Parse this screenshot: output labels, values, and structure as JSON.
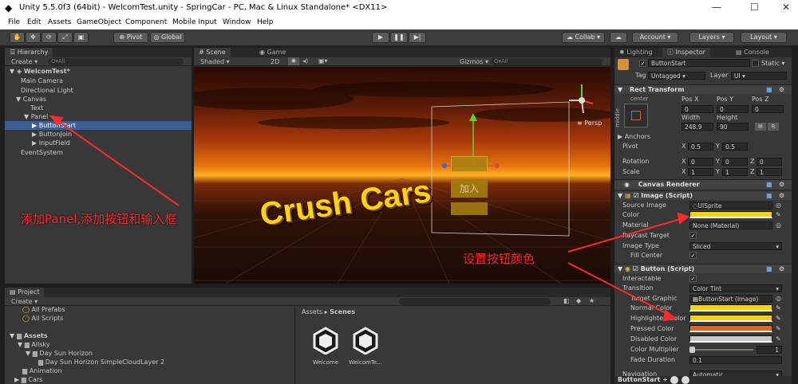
{
  "window": {
    "title": "Unity 5.5.0f3 (64bit) - WelcomTest.unity - SpringCar - PC, Mac & Linux Standalone* <DX11>"
  },
  "menu": [
    "File",
    "Edit",
    "Assets",
    "GameObject",
    "Component",
    "Mobile Input",
    "Window",
    "Help"
  ],
  "toolbar": {
    "pivot": "Pivot",
    "global": "Global",
    "collab": "Collab",
    "account": "Account",
    "layers": "Layers",
    "layout": "Layout"
  },
  "hierarchy": {
    "tab": "Hierarchy",
    "create": "Create",
    "search_placeholder": "All",
    "scene": "WelcomTest*",
    "items": [
      "Main Camera",
      "Directional Light",
      "Canvas",
      "Text",
      "Panel",
      "ButtonStart",
      "ButtonJoin",
      "InputField",
      "EventSystem"
    ]
  },
  "scene_view": {
    "tab_scene": "Scene",
    "tab_game": "Game",
    "shading": "Shaded",
    "mode2d": "2D",
    "gizmos": "Gizmos",
    "search_placeholder": "All",
    "persp": "Persp",
    "game_title": "Crush Cars",
    "button_label": "加入"
  },
  "annotations": {
    "panel_note": "添加Panel,添加按钮和输入框",
    "color_note": "设置按钮颜色"
  },
  "inspector": {
    "tab_lighting": "Lighting",
    "tab_inspector": "Inspector",
    "tab_console": "Console",
    "object_name": "ButtonStart",
    "static": "Static",
    "tag_label": "Tag",
    "tag": "Untagged",
    "layer_label": "Layer",
    "layer": "UI",
    "rect_transform": "Rect Transform",
    "anchor_h": "center",
    "anchor_v": "middle",
    "pos_x_label": "Pos X",
    "pos_y_label": "Pos Y",
    "pos_z_label": "Pos Z",
    "pos_x": "0",
    "pos_y": "0",
    "pos_z": "0",
    "width_label": "Width",
    "height_label": "Height",
    "width": "248.9",
    "height": "90",
    "raw": "R",
    "anchors": "Anchors",
    "pivot": "Pivot",
    "rotation": "Rotation",
    "scale": "Scale",
    "x": "X",
    "y": "Y",
    "z": "Z",
    "pivot_x": "0.5",
    "pivot_y": "0.5",
    "rot_x": "0",
    "rot_y": "0",
    "rot_z": "0",
    "scale_x": "1",
    "scale_y": "1",
    "scale_z": "1",
    "canvas_renderer": "Canvas Renderer",
    "image_script": "Image (Script)",
    "source_image_label": "Source Image",
    "source_image": "UISprite",
    "color_label": "Color",
    "material_label": "Material",
    "material": "None (Material)",
    "raycast_label": "Raycast Target",
    "image_type_label": "Image Type",
    "image_type": "Sliced",
    "fill_center_label": "Fill Center",
    "button_script": "Button (Script)",
    "interactable_label": "Interactable",
    "transition_label": "Transition",
    "transition": "Color Tint",
    "target_graphic_label": "Target Graphic",
    "target_graphic": "ButtonStart (Image)",
    "normal_label": "Normal Color",
    "highlighted_label": "Highlighted Color",
    "pressed_label": "Pressed Color",
    "disabled_label": "Disabled Color",
    "multiplier_label": "Color Multiplier",
    "multiplier": "1",
    "fade_label": "Fade Duration",
    "fade": "0.1",
    "navigation_label": "Navigation",
    "navigation": "Automatic",
    "footer": "ButtonStart"
  },
  "project": {
    "tab": "Project",
    "create": "Create",
    "favorites": [
      "All Prefabs",
      "All Scripts"
    ],
    "tree": [
      "Assets",
      "Allsky",
      "Day Sun Horizon",
      "Day Sun Horizon SimpleCloudLayer 2",
      "Animation",
      "Cars"
    ],
    "breadcrumb_root": "Assets",
    "breadcrumb_leaf": "Scenes",
    "files": [
      "Welcome",
      "WelcomTe..."
    ]
  },
  "colors": {
    "accent": "#3e5f96",
    "button_yellow": "#f5d20a",
    "pressed_orange": "#e8641e",
    "disabled_gray": "#c8c8c8",
    "annotation_red": "#ff2a2a"
  }
}
